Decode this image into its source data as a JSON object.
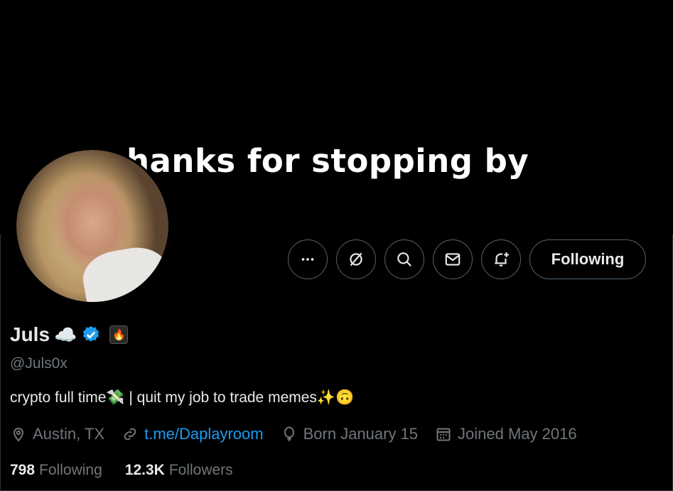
{
  "banner": {
    "text": "hanks for stopping by"
  },
  "actions": {
    "more_icon": "more-horizontal-icon",
    "grok_icon": "grok-icon",
    "search_icon": "search-icon",
    "message_icon": "mail-icon",
    "notify_icon": "bell-plus-icon",
    "following_label": "Following"
  },
  "profile": {
    "name": "Juls",
    "name_emoji": "☁️",
    "verified_color": "#1d9bf0",
    "affiliate_emoji": "🔥",
    "handle": "@Juls0x",
    "bio": "crypto full time💸 | quit my job to trade memes✨🙃"
  },
  "meta": {
    "location": "Austin, TX",
    "link": "t.me/Daplayroom",
    "birthday": "Born January 15",
    "joined": "Joined May 2016"
  },
  "counts": {
    "following_num": "798",
    "following_label": "Following",
    "followers_num": "12.3K",
    "followers_label": "Followers"
  },
  "colors": {
    "accent": "#1d9bf0",
    "muted": "#71767b",
    "text": "#e7e9ea",
    "bg": "#000000"
  }
}
